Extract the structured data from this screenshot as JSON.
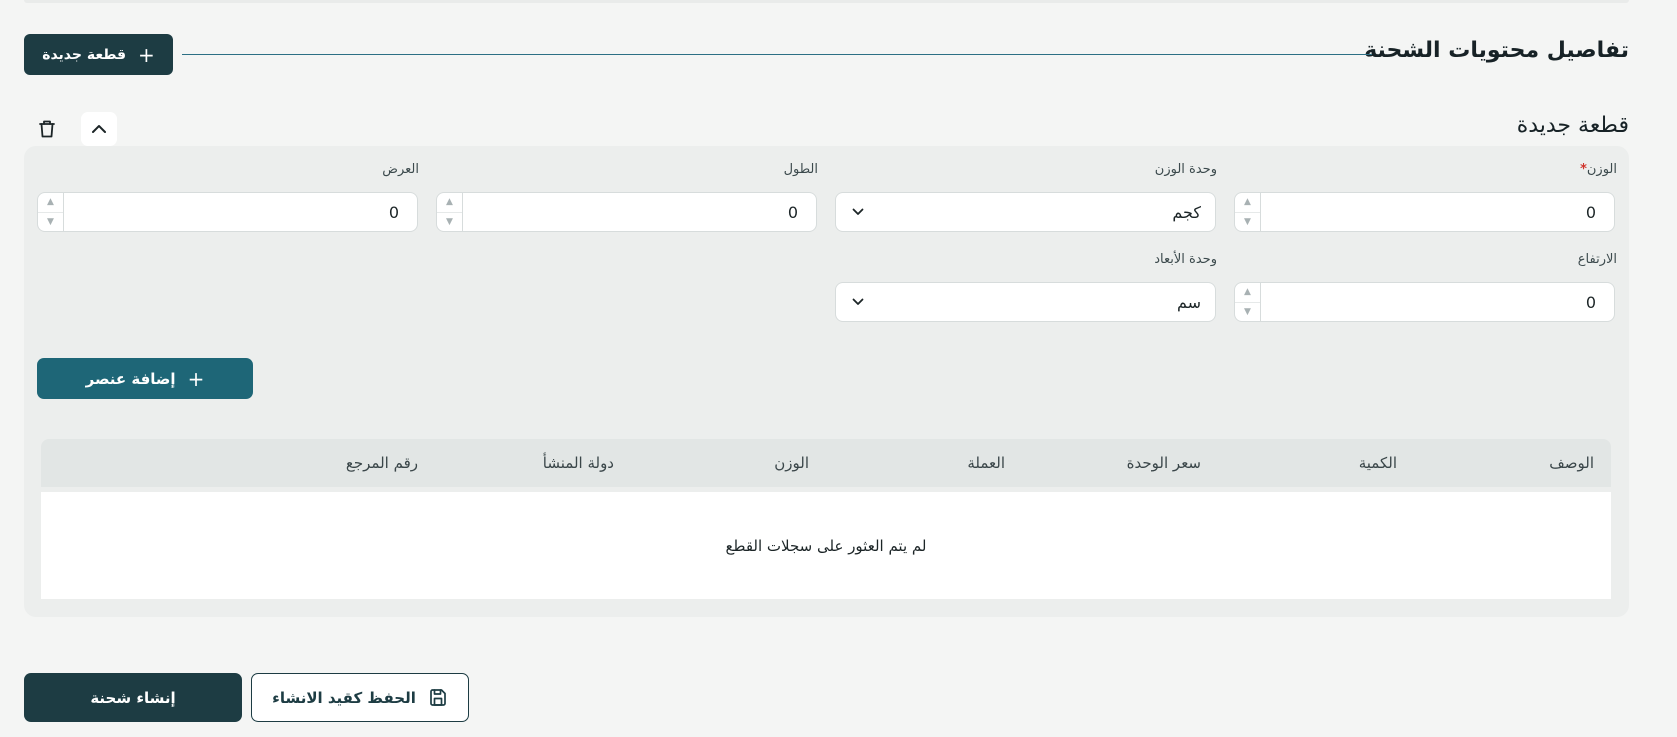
{
  "section": {
    "title": "تفاصيل محتويات الشحنة",
    "new_piece_label": "قطعة جديدة"
  },
  "piece": {
    "title": "قطعة جديدة",
    "fields": {
      "weight": {
        "label": "الوزن",
        "required_mark": "*",
        "value": "0"
      },
      "weight_unit": {
        "label": "وحدة الوزن",
        "value": "كجم"
      },
      "length": {
        "label": "الطول",
        "value": "0"
      },
      "width": {
        "label": "العرض",
        "value": "0"
      },
      "height": {
        "label": "الارتفاع",
        "value": "0"
      },
      "dimension_unit": {
        "label": "وحدة الأبعاد",
        "value": "سم"
      }
    },
    "add_item_label": "إضافة عنصر"
  },
  "table": {
    "columns": [
      "الوصف",
      "الكمية",
      "سعر الوحدة",
      "العملة",
      "الوزن",
      "دولة المنشأ",
      "رقم المرجع"
    ],
    "empty_message": "لم يتم العثور على سجلات القطع"
  },
  "footer": {
    "create_label": "إنشاء شحنة",
    "save_draft_label": "الحفظ كقيد الانشاء"
  },
  "icons": {
    "plus": "plus-icon",
    "trash": "trash-icon",
    "collapse": "chevron-up-icon",
    "select_arrow": "chevron-down-icon",
    "save": "save-icon"
  },
  "colors": {
    "primary_dark": "#1d3c43",
    "primary_teal": "#1e6677",
    "required": "#d0342c"
  }
}
